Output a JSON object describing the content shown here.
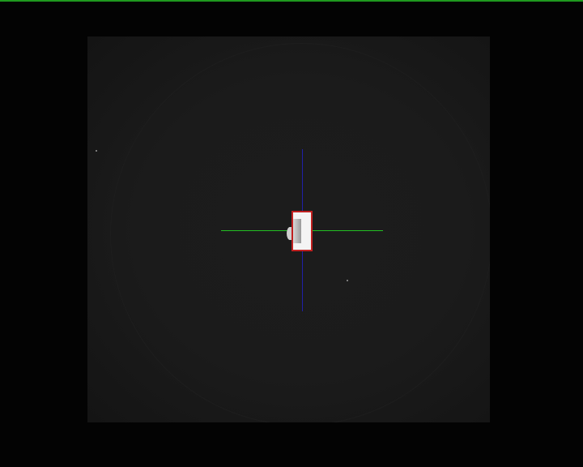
{
  "view": {
    "status_bar_color": "#1f9a1f",
    "sensor_color": "#1a1a1a",
    "crosshair": {
      "horizontal_color": "#22c022",
      "vertical_color": "#2020a8"
    },
    "target_box": {
      "border_color": "#c02020",
      "fill_color": "#f4f4f4"
    }
  }
}
